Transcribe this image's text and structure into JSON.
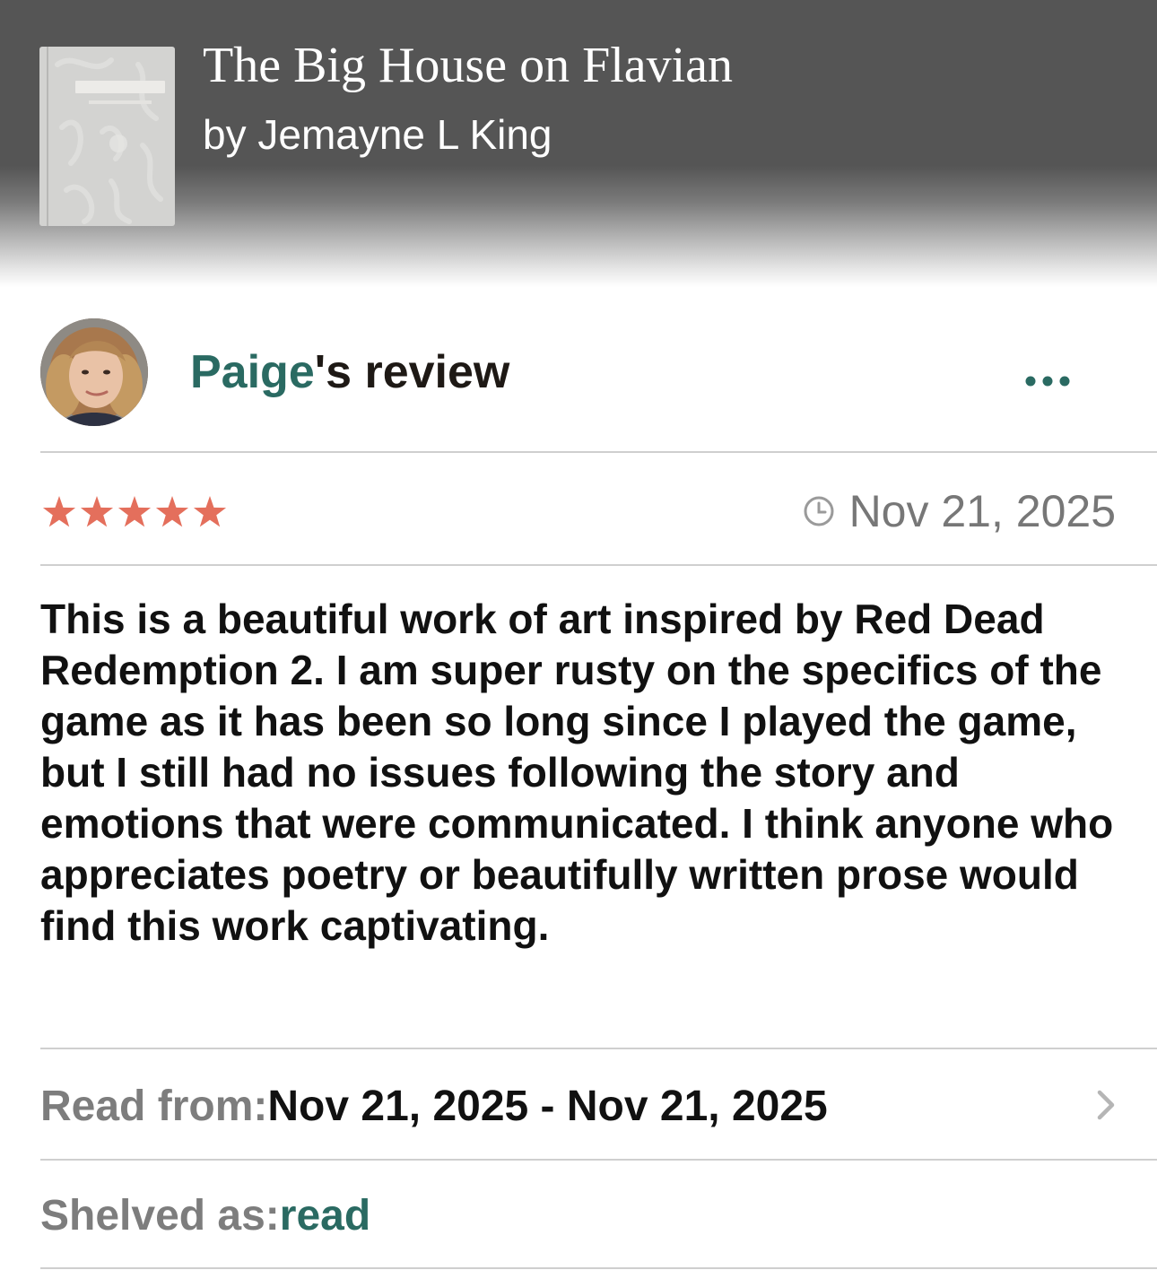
{
  "book": {
    "title": "The Big House on Flavian",
    "author": "by Jemayne L King"
  },
  "review": {
    "reviewer_name": "Paige",
    "heading_suffix": "'s review",
    "more_icon": "more-horizontal-icon",
    "rating": 5,
    "rating_max": 5,
    "date": "Nov 21, 2025",
    "body": "This is a beautiful work of art inspired by Red Dead Redemption 2. I am super rusty on the specifics of the game as it has been so long since I played the game, but I still had no issues following the story and emotions that were communicated. I think anyone who appreciates poetry or beautifully written prose would find this work captivating."
  },
  "read": {
    "label": "Read from: ",
    "dates": "Nov 21, 2025 - Nov 21, 2025"
  },
  "shelf": {
    "label": "Shelved as: ",
    "value": "read"
  },
  "colors": {
    "header_bg": "#555555",
    "accent_green": "#2a6a62",
    "star_color": "#e46f5c",
    "muted_text": "#7d7d7d"
  }
}
